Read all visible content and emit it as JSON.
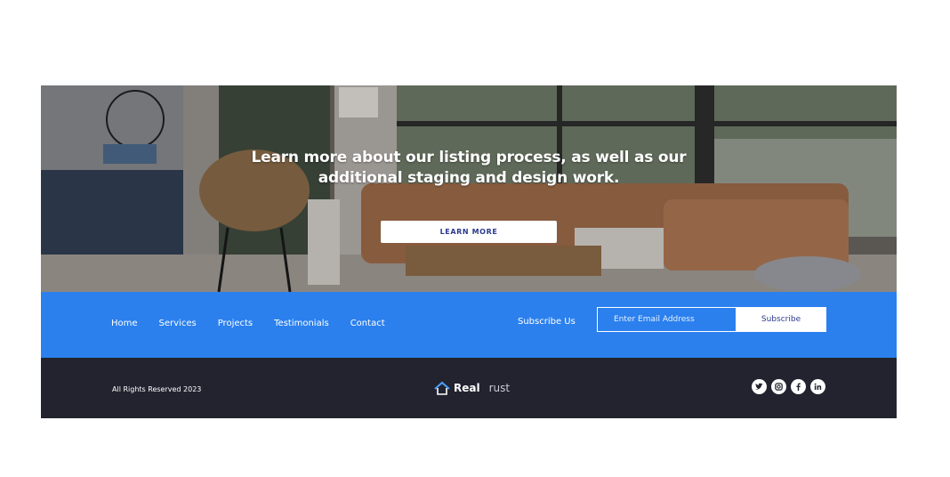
{
  "hero": {
    "title_line1": "Learn more about our listing process, as well as our",
    "title_line2": "additional staging and design work.",
    "button_label": "LEARN MORE"
  },
  "nav": {
    "items": [
      {
        "label": "Home"
      },
      {
        "label": "Services"
      },
      {
        "label": "Projects"
      },
      {
        "label": "Testimonials"
      },
      {
        "label": "Contact"
      }
    ]
  },
  "subscribe": {
    "label": "Subscribe Us",
    "placeholder": "Enter Email Address",
    "button_label": "Subscribe"
  },
  "footer": {
    "copyright": "All Rights Reserved 2023",
    "brand_part1": "Real",
    "brand_part2": "rust",
    "social_icons": [
      "twitter-icon",
      "instagram-icon",
      "facebook-icon",
      "linkedin-icon"
    ]
  },
  "colors": {
    "blue_bar": "#2b80ee",
    "footer_bg": "#22232f",
    "button_text": "#2b3a8f"
  }
}
